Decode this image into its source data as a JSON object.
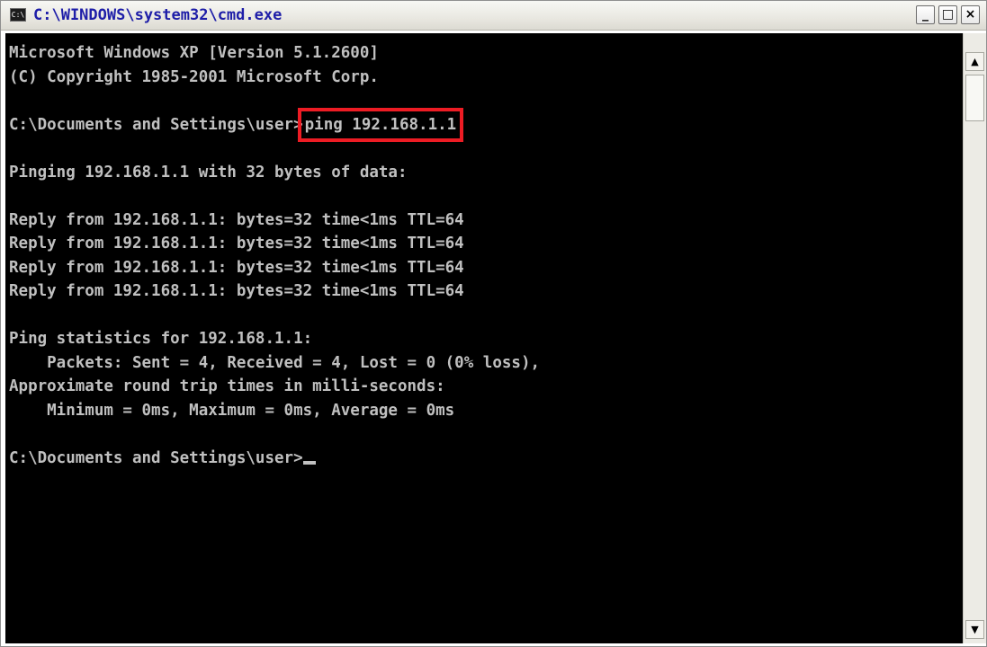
{
  "window": {
    "title": "C:\\WINDOWS\\system32\\cmd.exe",
    "icon": "console-app-icon",
    "controls": {
      "minimize": "_",
      "maximize": "□",
      "close": "×"
    }
  },
  "console": {
    "lines": [
      "Microsoft Windows XP [Version 5.1.2600]",
      "(C) Copyright 1985-2001 Microsoft Corp.",
      "",
      "",
      "",
      "Pinging 192.168.1.1 with 32 bytes of data:",
      "",
      "Reply from 192.168.1.1: bytes=32 time<1ms TTL=64",
      "Reply from 192.168.1.1: bytes=32 time<1ms TTL=64",
      "Reply from 192.168.1.1: bytes=32 time<1ms TTL=64",
      "Reply from 192.168.1.1: bytes=32 time<1ms TTL=64",
      "",
      "Ping statistics for 192.168.1.1:",
      "    Packets: Sent = 4, Received = 4, Lost = 0 (0% loss),",
      "Approximate round trip times in milli-seconds:",
      "    Minimum = 0ms, Maximum = 0ms, Average = 0ms",
      "",
      ""
    ],
    "command_prompt": "C:\\Documents and Settings\\user>",
    "highlighted_command": "ping 192.168.1.1",
    "final_prompt": "C:\\Documents and Settings\\user>",
    "highlight_color": "#ed1c24"
  },
  "scrollbar": {
    "up_arrow": "▲",
    "down_arrow": "▼"
  }
}
